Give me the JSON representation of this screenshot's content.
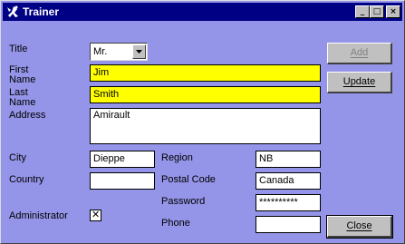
{
  "window": {
    "title": "Trainer",
    "controls": {
      "minimize": "_",
      "maximize": "□",
      "close": "×"
    }
  },
  "form": {
    "title": {
      "label": "Title",
      "value": "Mr."
    },
    "first_name": {
      "label": "First Name",
      "value": "Jim"
    },
    "last_name": {
      "label": "Last Name",
      "value": "Smith"
    },
    "address": {
      "label": "Address",
      "value": "Amirault"
    },
    "city": {
      "label": "City",
      "value": "Dieppe"
    },
    "region": {
      "label": "Region",
      "value": "NB"
    },
    "country": {
      "label": "Country",
      "value": ""
    },
    "postal_code": {
      "label": "Postal Code",
      "value": "Canada"
    },
    "password": {
      "label": "Password",
      "value": "**********"
    },
    "administrator": {
      "label": "Administrator",
      "checked": true,
      "mark": "✕"
    },
    "phone": {
      "label": "Phone",
      "value": ""
    }
  },
  "buttons": {
    "add": "Add",
    "update": "Update",
    "close": "Close"
  },
  "icons": {
    "app": "trainer-app-icon",
    "dropdown": "chevron-down-icon"
  },
  "colors": {
    "background": "#9494e8",
    "titlebar": "#000084",
    "highlight_field": "#ffff00"
  }
}
